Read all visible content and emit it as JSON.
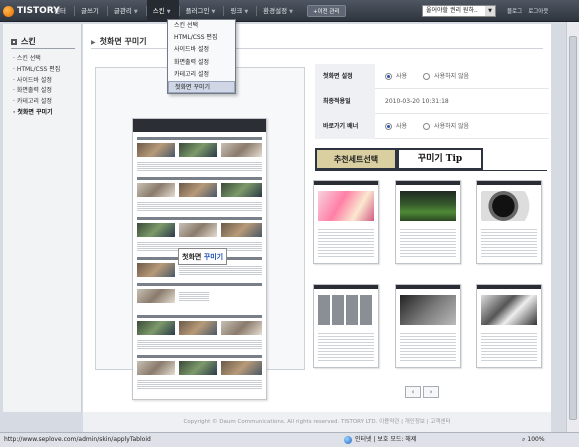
{
  "brand": {
    "name": "TISTORY"
  },
  "menu": {
    "items": [
      {
        "label": "센터"
      },
      {
        "label": "글쓰기"
      },
      {
        "label": "글관리"
      },
      {
        "label": "스킨"
      },
      {
        "label": "플러그인"
      },
      {
        "label": "링크"
      },
      {
        "label": "환경설정"
      }
    ],
    "admin_button": "+이전 관리",
    "blog_select": "울어야할 권리 원하..",
    "right_links": [
      "블로그",
      "로그아웃"
    ]
  },
  "dropdown": {
    "items": [
      "스킨 선택",
      "HTML/CSS 편집",
      "사이드바 설정",
      "화면출력 설정",
      "카테고리 설정",
      "첫화면 꾸미기"
    ],
    "selected": "첫화면 꾸미기"
  },
  "sidebar": {
    "title": "스킨",
    "items": [
      "스킨 선택",
      "HTML/CSS 편집",
      "사이드바 설정",
      "화면출력 설정",
      "카테고리 설정",
      "첫화면 꾸미기"
    ],
    "current": "첫화면 꾸미기"
  },
  "page": {
    "title": "첫화면 꾸미기"
  },
  "preview": {
    "label_a": "첫화면",
    "label_b": "꾸미기"
  },
  "settings": {
    "rows": [
      {
        "key": "첫화면 설정",
        "options": [
          "사용",
          "사용하지 않음"
        ],
        "selected": "사용"
      },
      {
        "key": "최종적용일",
        "value": "2010-03-20 10:31:18"
      },
      {
        "key": "바로가기 배너",
        "options": [
          "사용",
          "사용하지 않음"
        ],
        "selected": "사용"
      }
    ]
  },
  "tabs": {
    "recommend": "추천세트선택",
    "tip": "꾸미기 Tip",
    "active": "추천세트선택"
  },
  "pager": {
    "prev": "‹",
    "next": "›"
  },
  "footer": {
    "text": "Copyright © Daum Communications. All rights reserved. TISTORY LTD. 이용약관 | 개인정보 | 고객센터"
  },
  "status": {
    "url": "http://www.seplove.com/admin/skin/applyTabloid",
    "zone": "인터넷 | 보호 모드: 해제",
    "zoom": "100%"
  }
}
